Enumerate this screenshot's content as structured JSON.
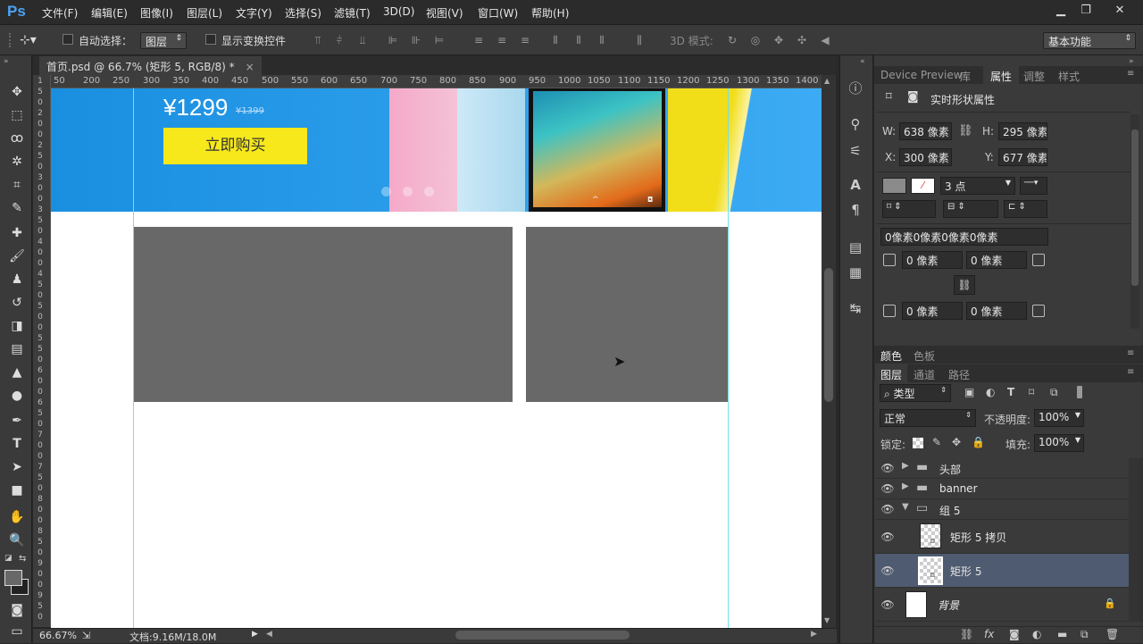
{
  "app": {
    "logo": "Ps"
  },
  "menu": [
    "文件(F)",
    "编辑(E)",
    "图像(I)",
    "图层(L)",
    "文字(Y)",
    "选择(S)",
    "滤镜(T)",
    "3D(D)",
    "视图(V)",
    "窗口(W)",
    "帮助(H)"
  ],
  "window_buttons": {
    "minimize": "▁",
    "restore": "❐",
    "close": "✕"
  },
  "options": {
    "auto_select_label": "自动选择：",
    "auto_select_value": "图层",
    "show_transform_label": "显示变换控件",
    "mode_3d_label": "3D 模式:",
    "workspace": "基本功能"
  },
  "document_tab": {
    "title": "首页.psd @ 66.7% (矩形 5, RGB/8) *",
    "close": "×"
  },
  "ruler_labels": [
    "50",
    "200",
    "250",
    "300",
    "350",
    "400",
    "450",
    "500",
    "550",
    "600",
    "650",
    "700",
    "750",
    "800",
    "850",
    "900",
    "950",
    "1000",
    "1050",
    "1100",
    "1150",
    "1200",
    "1250",
    "1300",
    "1350",
    "1400"
  ],
  "left_ruler_labels": [
    "1",
    "5",
    "0",
    "2",
    "0",
    "0",
    "2",
    "5",
    "0",
    "3",
    "0",
    "0",
    "3",
    "5",
    "0",
    "4",
    "0",
    "0",
    "4",
    "5",
    "0",
    "5",
    "0",
    "0",
    "5",
    "5",
    "0",
    "6",
    "0",
    "0",
    "6",
    "5",
    "0",
    "7",
    "0",
    "0",
    "7",
    "5",
    "0",
    "8",
    "0",
    "0",
    "8",
    "5",
    "0",
    "9",
    "0",
    "0",
    "9",
    "5",
    "0"
  ],
  "canvas": {
    "price": "¥1299",
    "old_price": "¥1399",
    "buy_button": "立即购买",
    "banner_color": "#2a9de8",
    "buy_color": "#f6e81b",
    "rect_color": "#686868",
    "guide_color": "#6fe0ea"
  },
  "status": {
    "zoom": "66.67%",
    "doc": "文档:9.16M/18.0M"
  },
  "properties_panel": {
    "tabs": [
      "Device Preview",
      "库",
      "属性",
      "调整",
      "样式"
    ],
    "active_tab": "属性",
    "title": "实时形状属性",
    "w_label": "W:",
    "w_value": "638 像素",
    "h_label": "H:",
    "h_value": "295 像素",
    "x_label": "X:",
    "x_value": "300 像素",
    "y_label": "Y:",
    "y_value": "677 像素",
    "stroke_width": "3 点",
    "corner_all": "0像素0像素0像素0像素",
    "corner_tl": "0 像素",
    "corner_tr": "0 像素",
    "corner_bl": "0 像素",
    "corner_br": "0 像素"
  },
  "color_panel": {
    "tabs": [
      "颜色",
      "色板"
    ]
  },
  "layers_panel": {
    "tabs": [
      "图层",
      "通道",
      "路径"
    ],
    "filter_kind": "类型",
    "blend_mode": "正常",
    "opacity_label": "不透明度:",
    "opacity_value": "100%",
    "lock_label": "锁定:",
    "fill_label": "填充:",
    "fill_value": "100%",
    "layers": [
      {
        "name": "头部",
        "type": "group",
        "expanded": false
      },
      {
        "name": "banner",
        "type": "group",
        "expanded": false
      },
      {
        "name": "组 5",
        "type": "group",
        "expanded": true
      },
      {
        "name": "矩形 5 拷贝",
        "type": "shape",
        "selected": false
      },
      {
        "name": "矩形 5",
        "type": "shape",
        "selected": true
      },
      {
        "name": "背景",
        "type": "background",
        "locked": true
      }
    ]
  }
}
